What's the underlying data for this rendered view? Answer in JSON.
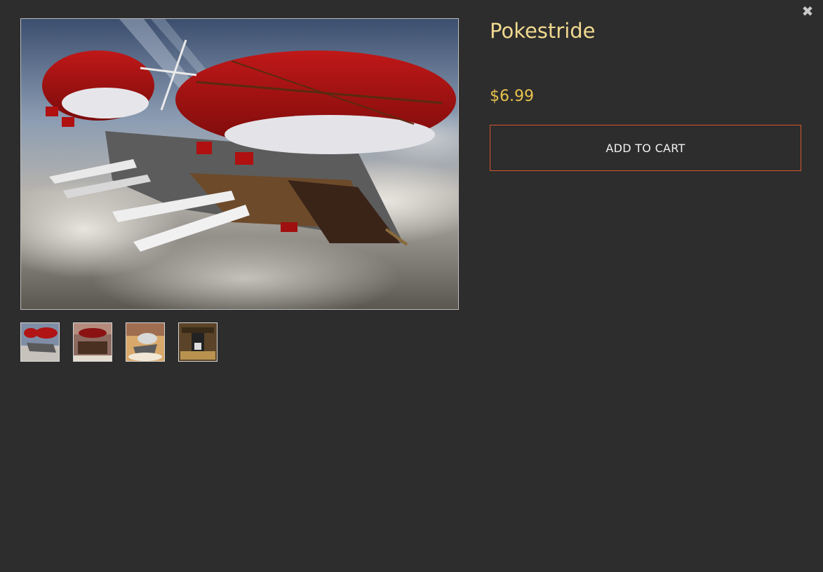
{
  "product": {
    "title": "Pokestride",
    "price": "$6.99",
    "add_to_cart_label": "ADD TO CART",
    "main_image_alt": "Pokestride",
    "thumbnail_count": 4,
    "selected_thumbnail": 1
  },
  "modal": {
    "close_icon": "close-icon",
    "close_glyph": "✖"
  },
  "colors": {
    "background": "#2d2d2d",
    "title": "#f1d98f",
    "price": "#e8c24f",
    "button_border": "#d5542a",
    "button_text": "#f2f2f2"
  }
}
